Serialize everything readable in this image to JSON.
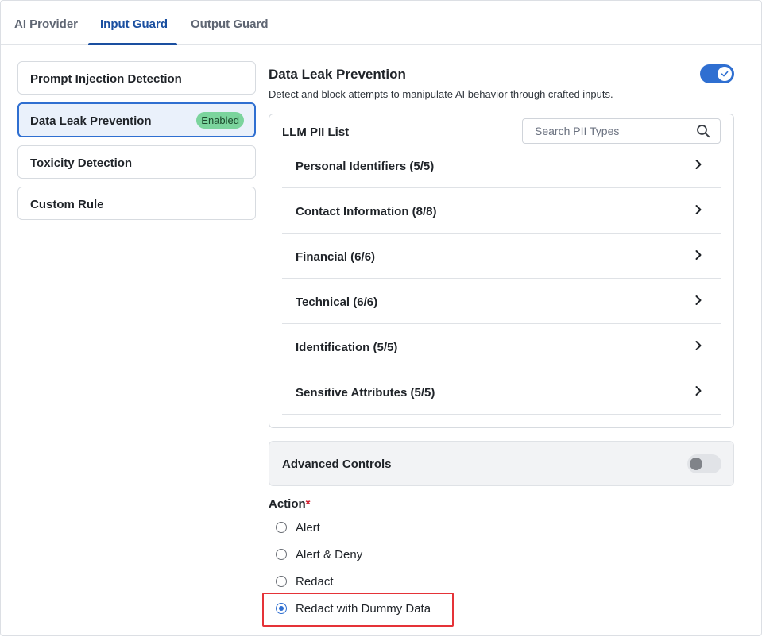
{
  "tabs": [
    {
      "label": "AI Provider"
    },
    {
      "label": "Input Guard"
    },
    {
      "label": "Output Guard"
    }
  ],
  "sidebar": {
    "items": [
      {
        "label": "Prompt Injection Detection"
      },
      {
        "label": "Data Leak Prevention",
        "badge": "Enabled"
      },
      {
        "label": "Toxicity Detection"
      },
      {
        "label": "Custom Rule"
      }
    ]
  },
  "main": {
    "title": "Data Leak Prevention",
    "description": "Detect and block attempts to manipulate AI behavior through crafted inputs.",
    "enabled": true
  },
  "pii": {
    "title": "LLM PII List",
    "search_placeholder": "Search PII Types",
    "rows": [
      {
        "label": "Personal Identifiers (5/5)"
      },
      {
        "label": "Contact Information (8/8)"
      },
      {
        "label": "Financial (6/6)"
      },
      {
        "label": "Technical (6/6)"
      },
      {
        "label": "Identification (5/5)"
      },
      {
        "label": "Sensitive Attributes (5/5)"
      }
    ]
  },
  "advanced": {
    "label": "Advanced Controls",
    "enabled": false
  },
  "action": {
    "label": "Action",
    "required_mark": "*",
    "options": [
      {
        "label": "Alert",
        "selected": false
      },
      {
        "label": "Alert & Deny",
        "selected": false
      },
      {
        "label": "Redact",
        "selected": false
      },
      {
        "label": "Redact with Dummy Data",
        "selected": true
      }
    ]
  },
  "colors": {
    "accent": "#2f6fd1",
    "tab_active": "#1a4fa0",
    "badge_bg": "#7bd49d",
    "highlight": "#e53338"
  }
}
